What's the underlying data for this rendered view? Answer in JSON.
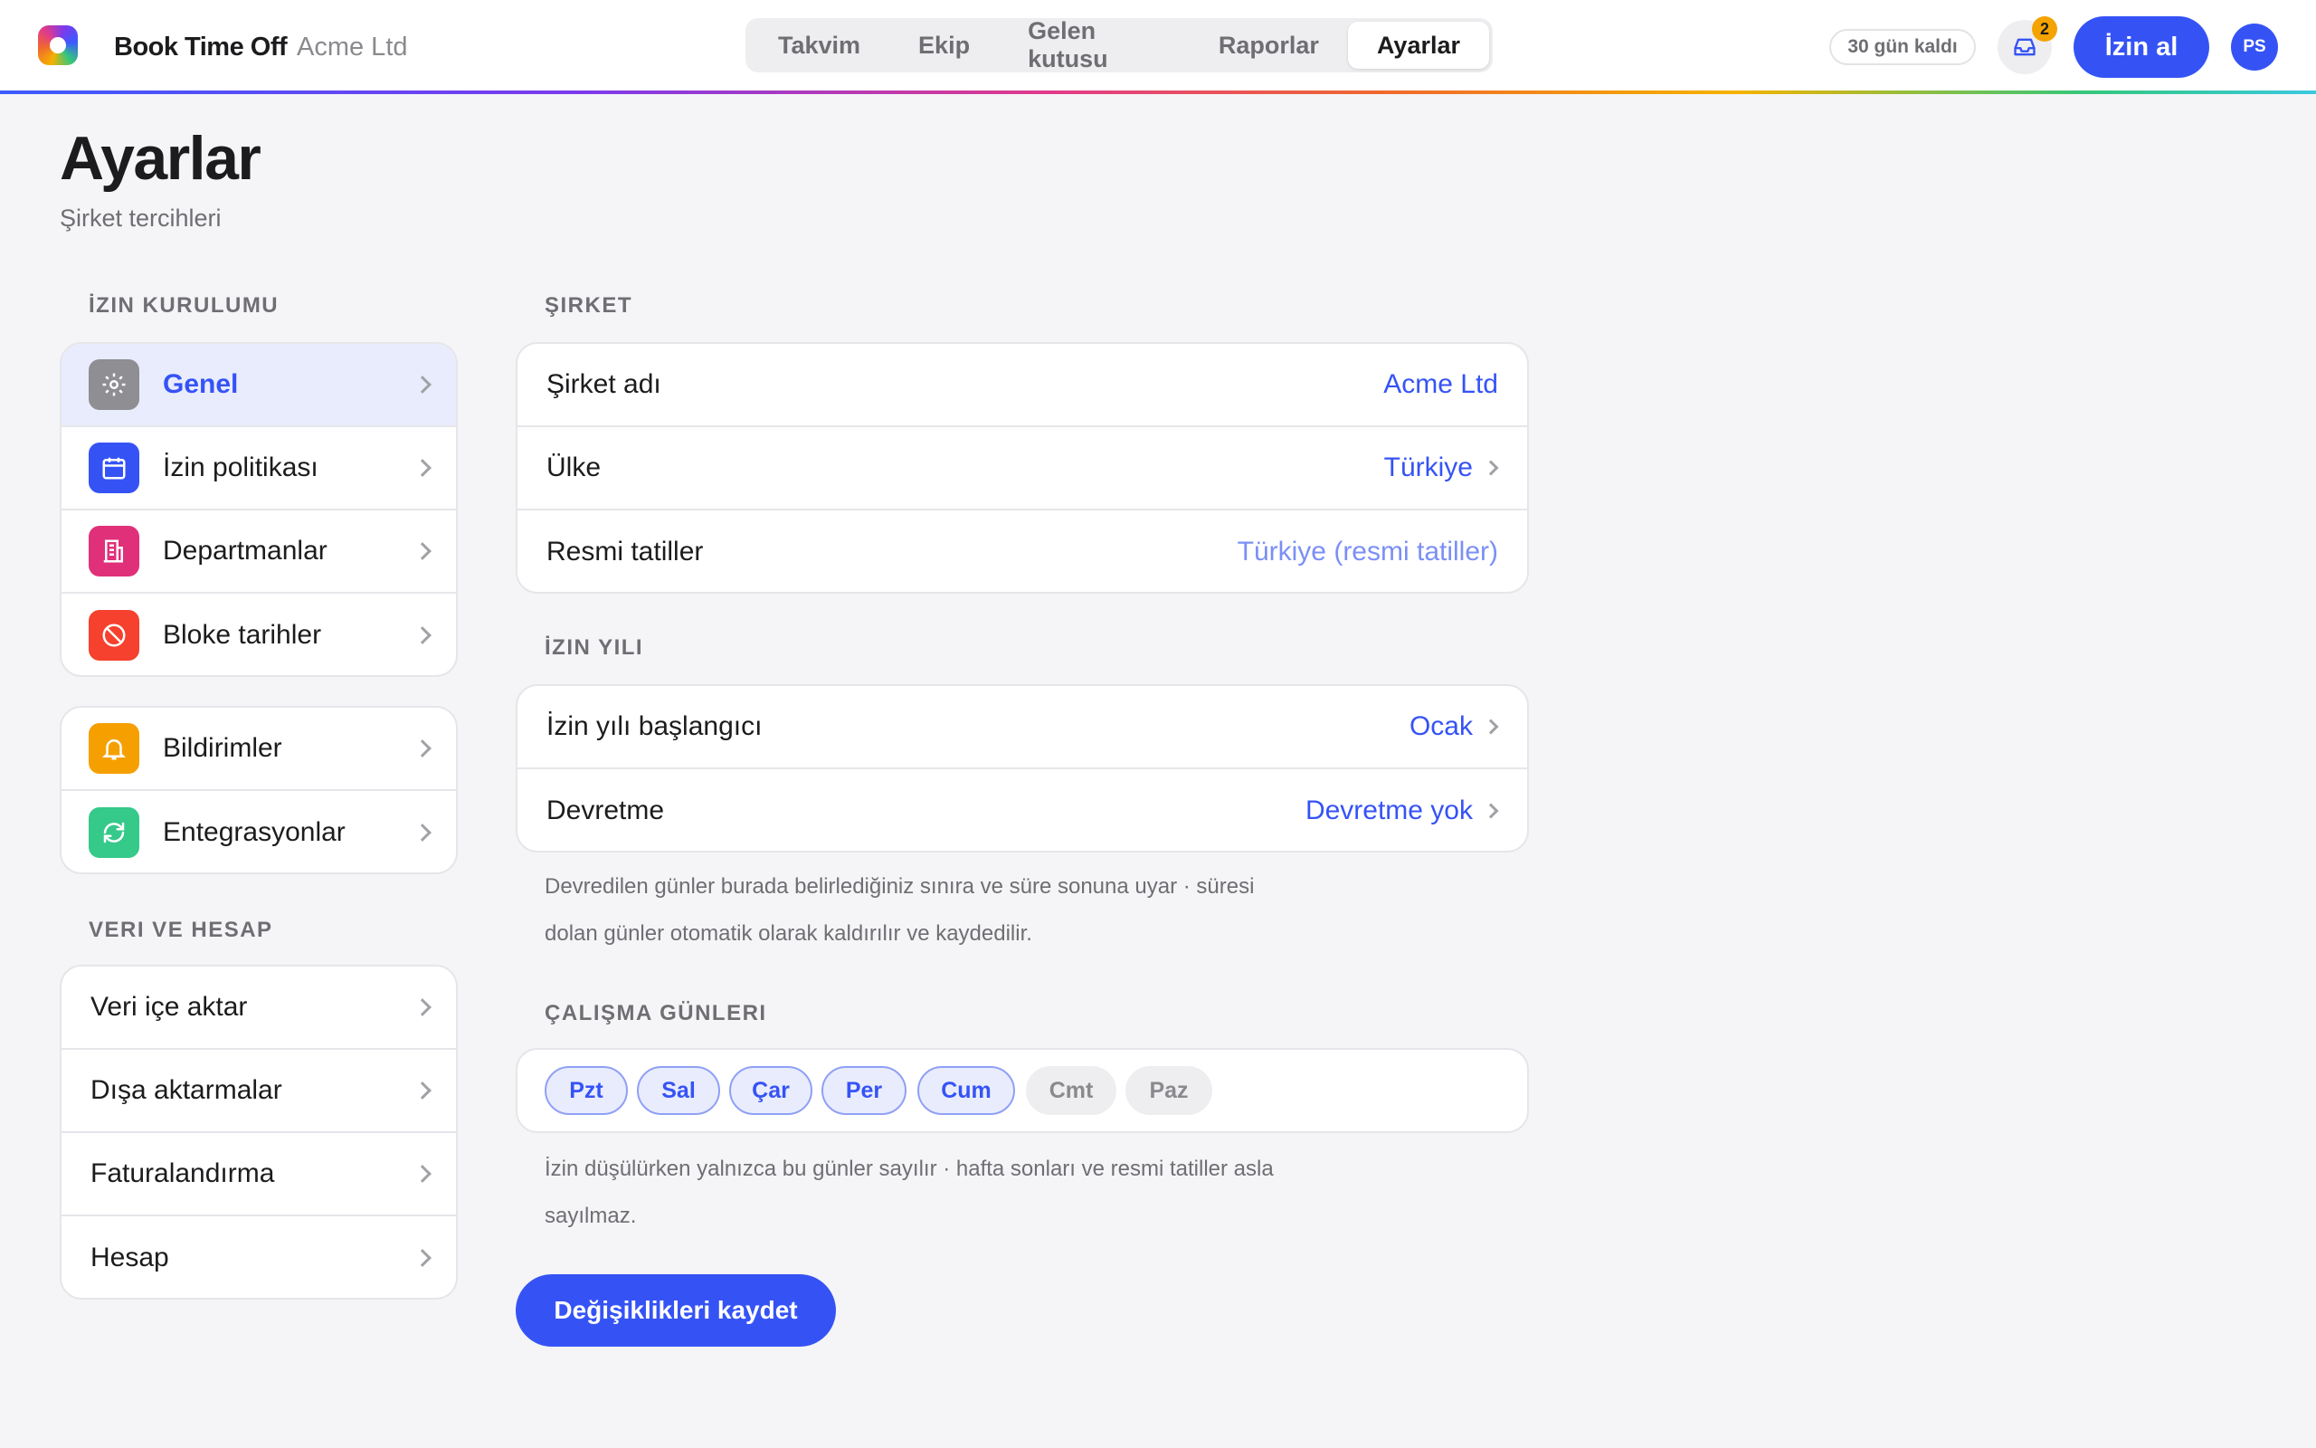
{
  "app": {
    "brand": "Book Time Off",
    "company": "Acme Ltd"
  },
  "nav": {
    "tabs": [
      {
        "label": "Takvim"
      },
      {
        "label": "Ekip"
      },
      {
        "label": "Gelen kutusu"
      },
      {
        "label": "Raporlar"
      },
      {
        "label": "Ayarlar",
        "active": true
      }
    ]
  },
  "header_actions": {
    "trial": "30 gün kaldı",
    "inbox_count": "2",
    "book_leave": "İzin al",
    "avatar_initials": "PS"
  },
  "page": {
    "title": "Ayarlar",
    "subtitle": "Şirket tercihleri"
  },
  "sidebar": {
    "section1_label": "İZIN KURULUMU",
    "group1": [
      {
        "label": "Genel",
        "icon": "gear-icon",
        "color": "#8e8e93",
        "active": true
      },
      {
        "label": "İzin politikası",
        "icon": "calendar-icon",
        "color": "#3553f5"
      },
      {
        "label": "Departmanlar",
        "icon": "building-icon",
        "color": "#e0307a"
      },
      {
        "label": "Bloke tarihler",
        "icon": "block-icon",
        "color": "#f5412d"
      }
    ],
    "group2": [
      {
        "label": "Bildirimler",
        "icon": "bell-icon",
        "color": "#f5a000"
      },
      {
        "label": "Entegrasyonlar",
        "icon": "sync-icon",
        "color": "#35c98a"
      }
    ],
    "section2_label": "VERI VE HESAP",
    "group3": [
      {
        "label": "Veri içe aktar"
      },
      {
        "label": "Dışa aktarmalar"
      },
      {
        "label": "Faturalandırma"
      },
      {
        "label": "Hesap"
      }
    ]
  },
  "company_section": {
    "label": "ŞIRKET",
    "rows": [
      {
        "label": "Şirket adı",
        "value": "Acme Ltd"
      },
      {
        "label": "Ülke",
        "value": "Türkiye"
      },
      {
        "label": "Resmi tatiller",
        "value": "Türkiye (resmi tatiller)"
      }
    ]
  },
  "leave_year_section": {
    "label": "İZIN YILI",
    "rows": [
      {
        "label": "İzin yılı başlangıcı",
        "value": "Ocak"
      },
      {
        "label": "Devretme",
        "value": "Devretme yok"
      }
    ],
    "note_line1": "Devredilen günler burada belirlediğiniz sınıra ve süre sonuna uyar · süresi",
    "note_line2": "dolan günler otomatik olarak kaldırılır ve kaydedilir."
  },
  "working_days_section": {
    "label": "ÇALIŞMA GÜNLERI",
    "days": [
      {
        "label": "Pzt",
        "on": true
      },
      {
        "label": "Sal",
        "on": true
      },
      {
        "label": "Çar",
        "on": true
      },
      {
        "label": "Per",
        "on": true
      },
      {
        "label": "Cum",
        "on": true
      },
      {
        "label": "Cmt",
        "on": false
      },
      {
        "label": "Paz",
        "on": false
      }
    ],
    "note_line1": "İzin düşülürken yalnızca bu günler sayılır · hafta sonları ve resmi tatiller asla",
    "note_line2": "sayılmaz."
  },
  "save_label": "Değişiklikleri kaydet",
  "colors": {
    "accent": "#3553f5",
    "active_bg": "#e9ecfd"
  }
}
